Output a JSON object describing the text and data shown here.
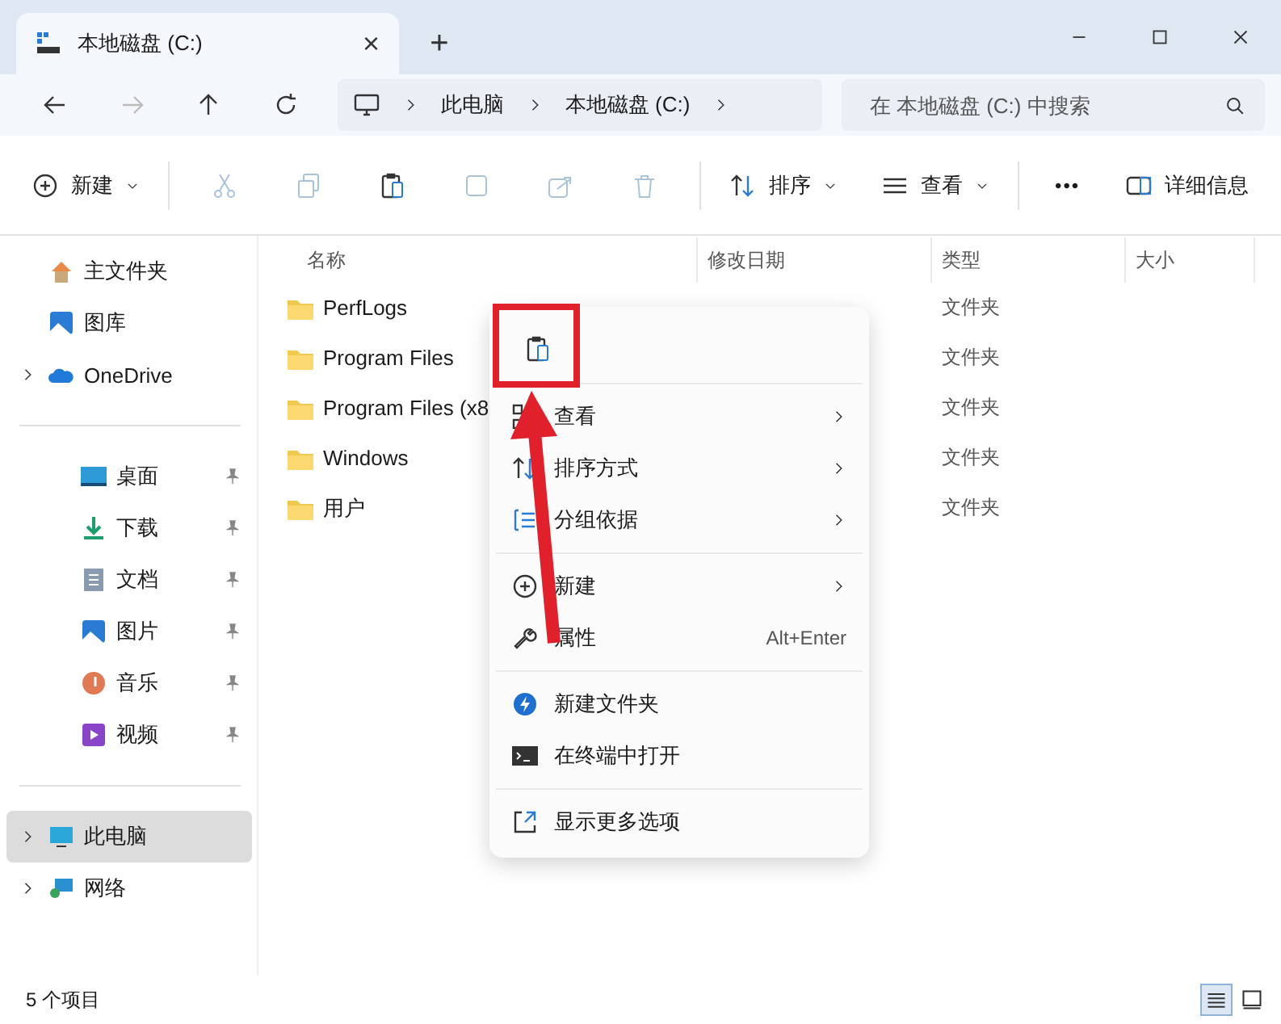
{
  "window": {
    "tab_title": "本地磁盘 (C:)",
    "tab_close": "×",
    "new_tab": "+"
  },
  "address": {
    "crumbs": [
      "此电脑",
      "本地磁盘 (C:)"
    ],
    "search_placeholder": "在 本地磁盘 (C:) 中搜索"
  },
  "toolbar": {
    "new": "新建",
    "sort": "排序",
    "view": "查看",
    "more": "•••",
    "details": "详细信息"
  },
  "sidebar": {
    "groups": [
      [
        {
          "label": "主文件夹",
          "expandable": false,
          "pinned": false,
          "selected": false
        },
        {
          "label": "图库",
          "expandable": false,
          "pinned": false,
          "selected": false
        },
        {
          "label": "OneDrive",
          "expandable": true,
          "pinned": false,
          "selected": false
        }
      ],
      [
        {
          "label": "桌面",
          "expandable": false,
          "pinned": true,
          "selected": false
        },
        {
          "label": "下载",
          "expandable": false,
          "pinned": true,
          "selected": false
        },
        {
          "label": "文档",
          "expandable": false,
          "pinned": true,
          "selected": false
        },
        {
          "label": "图片",
          "expandable": false,
          "pinned": true,
          "selected": false
        },
        {
          "label": "音乐",
          "expandable": false,
          "pinned": true,
          "selected": false
        },
        {
          "label": "视频",
          "expandable": false,
          "pinned": true,
          "selected": false
        }
      ],
      [
        {
          "label": "此电脑",
          "expandable": true,
          "pinned": false,
          "selected": true
        },
        {
          "label": "网络",
          "expandable": true,
          "pinned": false,
          "selected": false
        }
      ]
    ]
  },
  "table": {
    "columns": [
      "名称",
      "修改日期",
      "类型",
      "大小"
    ],
    "rows": [
      {
        "name": "PerfLogs",
        "type": "文件夹"
      },
      {
        "name": "Program Files",
        "type": "文件夹"
      },
      {
        "name": "Program Files (x8",
        "type": "文件夹"
      },
      {
        "name": "Windows",
        "type": "文件夹"
      },
      {
        "name": "用户",
        "type": "文件夹"
      }
    ]
  },
  "context_menu": {
    "items": [
      {
        "kind": "item",
        "label": "查看",
        "submenu": true
      },
      {
        "kind": "item",
        "label": "排序方式",
        "submenu": true
      },
      {
        "kind": "item",
        "label": "分组依据",
        "submenu": true
      },
      {
        "kind": "separator"
      },
      {
        "kind": "item",
        "label": "新建",
        "submenu": true
      },
      {
        "kind": "item",
        "label": "属性",
        "shortcut": "Alt+Enter",
        "submenu": false
      },
      {
        "kind": "separator"
      },
      {
        "kind": "item",
        "label": "新建文件夹",
        "submenu": false
      },
      {
        "kind": "item",
        "label": "在终端中打开",
        "submenu": false
      },
      {
        "kind": "separator"
      },
      {
        "kind": "item",
        "label": "显示更多选项",
        "submenu": false
      }
    ]
  },
  "status_bar": {
    "count": "5 个项目",
    "views": [
      {
        "selected": true
      },
      {
        "selected": false
      }
    ]
  }
}
